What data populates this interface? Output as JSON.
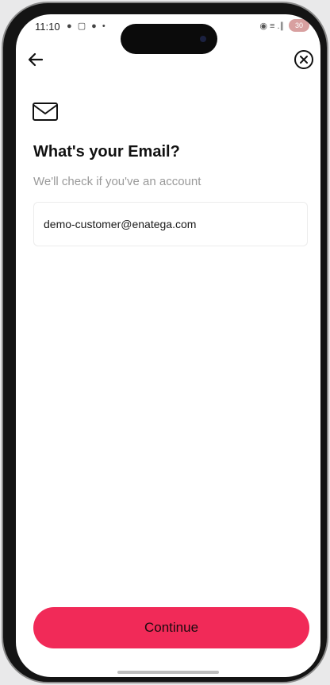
{
  "status_bar": {
    "time": "11:10",
    "left_icons": "● ▢ ● •",
    "right_icons": "◉ ≡ .∥",
    "battery": "30"
  },
  "nav": {
    "back_icon": "arrow-left-icon",
    "close_icon": "close-circle-icon"
  },
  "content": {
    "envelope_icon": "envelope-icon",
    "title": "What's your Email?",
    "subtitle": "We'll check if you've an account",
    "email_value": "demo-customer@enatega.com"
  },
  "footer": {
    "continue_label": "Continue"
  },
  "colors": {
    "accent": "#f12a58",
    "subtitle": "#9a9a9a"
  }
}
